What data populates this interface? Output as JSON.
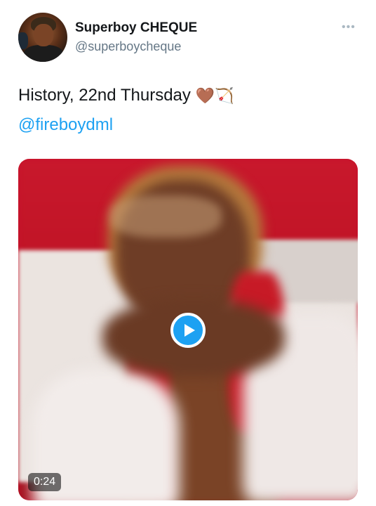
{
  "user": {
    "display_name": "Superboy CHEQUE",
    "handle": "@superboycheque"
  },
  "tweet": {
    "text": "History, 22nd Thursday",
    "emojis": "🤎🏹",
    "mention": "@fireboydml"
  },
  "media": {
    "duration": "0:24"
  },
  "icons": {
    "more": "more-options-icon",
    "play": "play-icon"
  },
  "colors": {
    "link": "#1da1f2",
    "text": "#14171a",
    "muted": "#657786",
    "video_bg": "#c8102e"
  }
}
